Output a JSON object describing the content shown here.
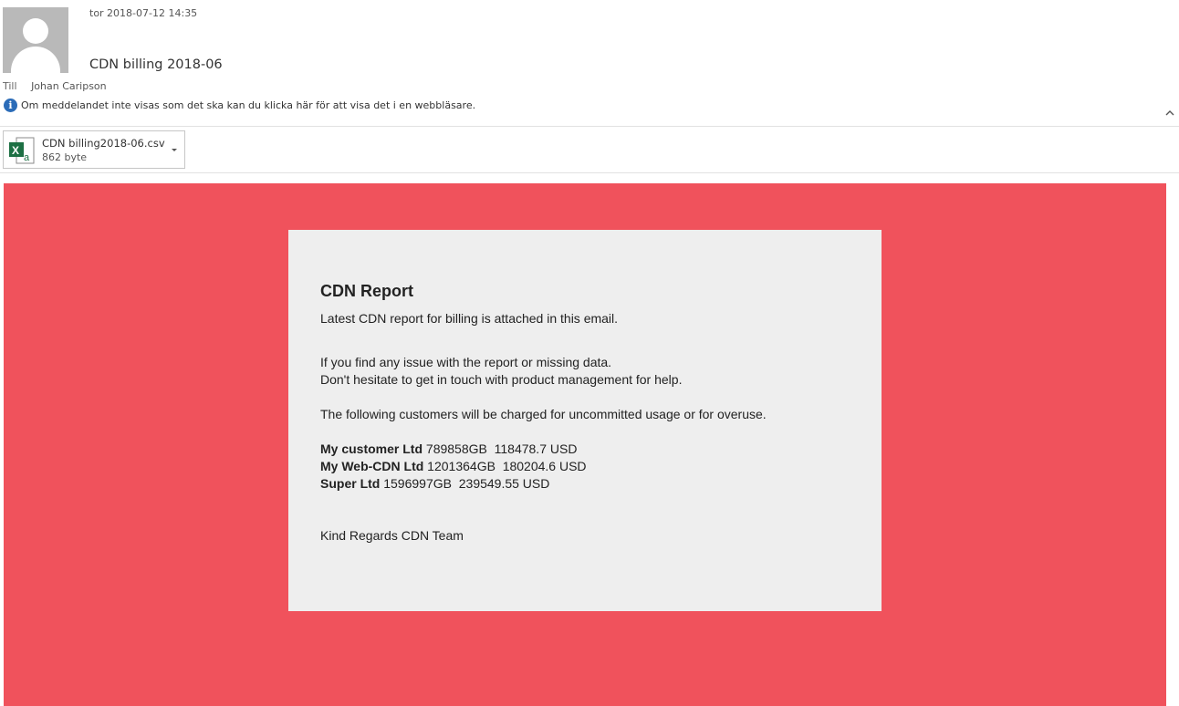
{
  "header": {
    "datetime": "tor 2018-07-12 14:35",
    "subject": "CDN billing 2018-06",
    "to_label": "Till",
    "to_name": "Johan Caripson",
    "info_text": "Om meddelandet inte visas som det ska kan du klicka här för att visa det i en webbläsare."
  },
  "attachment": {
    "filename": "CDN billing2018-06.csv",
    "size": "862 byte"
  },
  "email": {
    "background_color": "#f0525c",
    "card_color": "#eeeeee",
    "title": "CDN Report",
    "intro": "Latest CDN report for billing is attached in this email.",
    "issue_line1": "If you find any issue with the report or missing data.",
    "issue_line2": "Don't hesitate to get in touch with product management for help.",
    "charge_text": "The following customers will be charged for uncommitted usage or for overuse.",
    "customers": [
      {
        "name": "My customer Ltd",
        "details": " 789858GB  118478.7 USD"
      },
      {
        "name": "My Web-CDN Ltd",
        "details": " 1201364GB  180204.6 USD"
      },
      {
        "name": "Super Ltd",
        "details": " 1596997GB  239549.55 USD"
      }
    ],
    "signoff": "Kind Regards CDN Team"
  },
  "icons": {
    "avatar": "person-silhouette-icon",
    "info": "info-icon",
    "collapse": "chevron-up-icon",
    "attachment_type": "excel-csv-icon",
    "attachment_menu": "dropdown-arrow-icon"
  }
}
